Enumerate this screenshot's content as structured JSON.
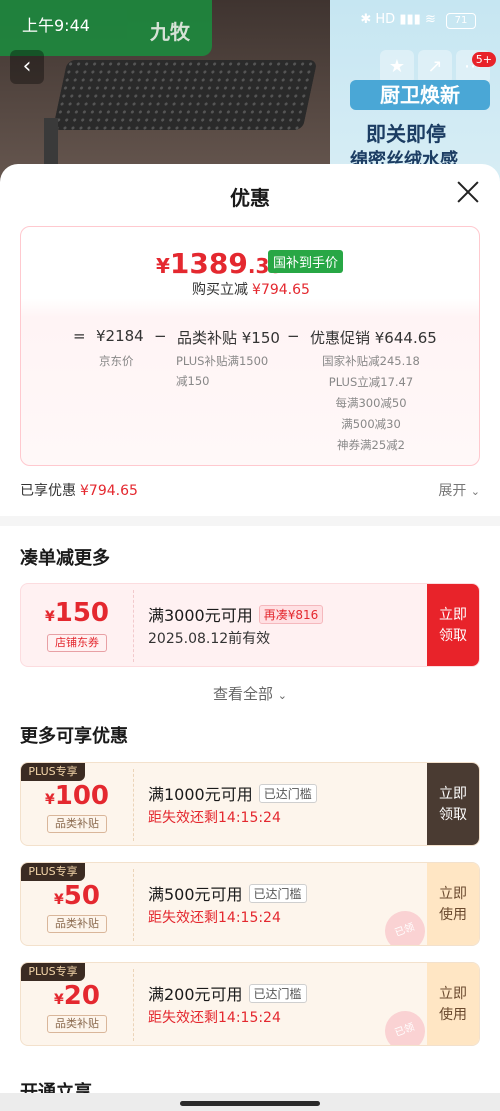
{
  "status": {
    "time": "上午9:44",
    "battery": "71",
    "net": "HD"
  },
  "background": {
    "brand": "九牧",
    "promo_title": "厨卫焕新",
    "promo_line1": "即关即停",
    "promo_line2": "绵密丝绒水感",
    "cart_badge": "5+"
  },
  "sheet": {
    "title": "优惠",
    "price": {
      "currency": "¥",
      "integer": "1389",
      "decimal": ".35",
      "tag": "国补到手价"
    },
    "reduce": {
      "label": "购买立减",
      "value": "¥794.65"
    },
    "formula": {
      "eq": "=",
      "jd_price": "¥2184",
      "minus1": "−",
      "category_subsidy": "品类补贴 ¥150",
      "minus2": "−",
      "promo": "优惠促销 ¥644.65",
      "jd_label": "京东价",
      "plus_note_1": "PLUS补贴满1500",
      "plus_note_2": "减150",
      "promo_notes": [
        "国家补贴减245.18",
        "PLUS立减17.47",
        "每满300减50",
        "满500减30",
        "神券满25减2"
      ]
    },
    "enjoyed": {
      "label": "已享优惠",
      "value": "¥794.65"
    },
    "expand": "展开"
  },
  "more_section": {
    "title": "凑单减更多",
    "coupon": {
      "currency": "¥",
      "amount": "150",
      "kind": "店铺东券",
      "condition": "满3000元可用",
      "tag": "再凑¥816",
      "valid": "2025.08.12前有效",
      "btn_line1": "立即",
      "btn_line2": "领取"
    },
    "view_all": "查看全部"
  },
  "extra_section": {
    "title": "更多可享优惠",
    "coupons": [
      {
        "plus": "PLUS专享",
        "currency": "¥",
        "amount": "100",
        "kind": "品类补贴",
        "condition": "满1000元可用",
        "tag": "已达门槛",
        "countdown": "距失效还剩14:15:24",
        "btn_line1": "立即",
        "btn_line2": "领取"
      },
      {
        "plus": "PLUS专享",
        "currency": "¥",
        "amount": "50",
        "kind": "品类补贴",
        "condition": "满500元可用",
        "tag": "已达门槛",
        "countdown": "距失效还剩14:15:24",
        "btn_line1": "立即",
        "btn_line2": "使用",
        "stamp": "已领"
      },
      {
        "plus": "PLUS专享",
        "currency": "¥",
        "amount": "20",
        "kind": "品类补贴",
        "condition": "满200元可用",
        "tag": "已达门槛",
        "countdown": "距失效还剩14:15:24",
        "btn_line1": "立即",
        "btn_line2": "使用",
        "stamp": "已领"
      }
    ]
  },
  "next_section": {
    "title": "开通立享"
  }
}
